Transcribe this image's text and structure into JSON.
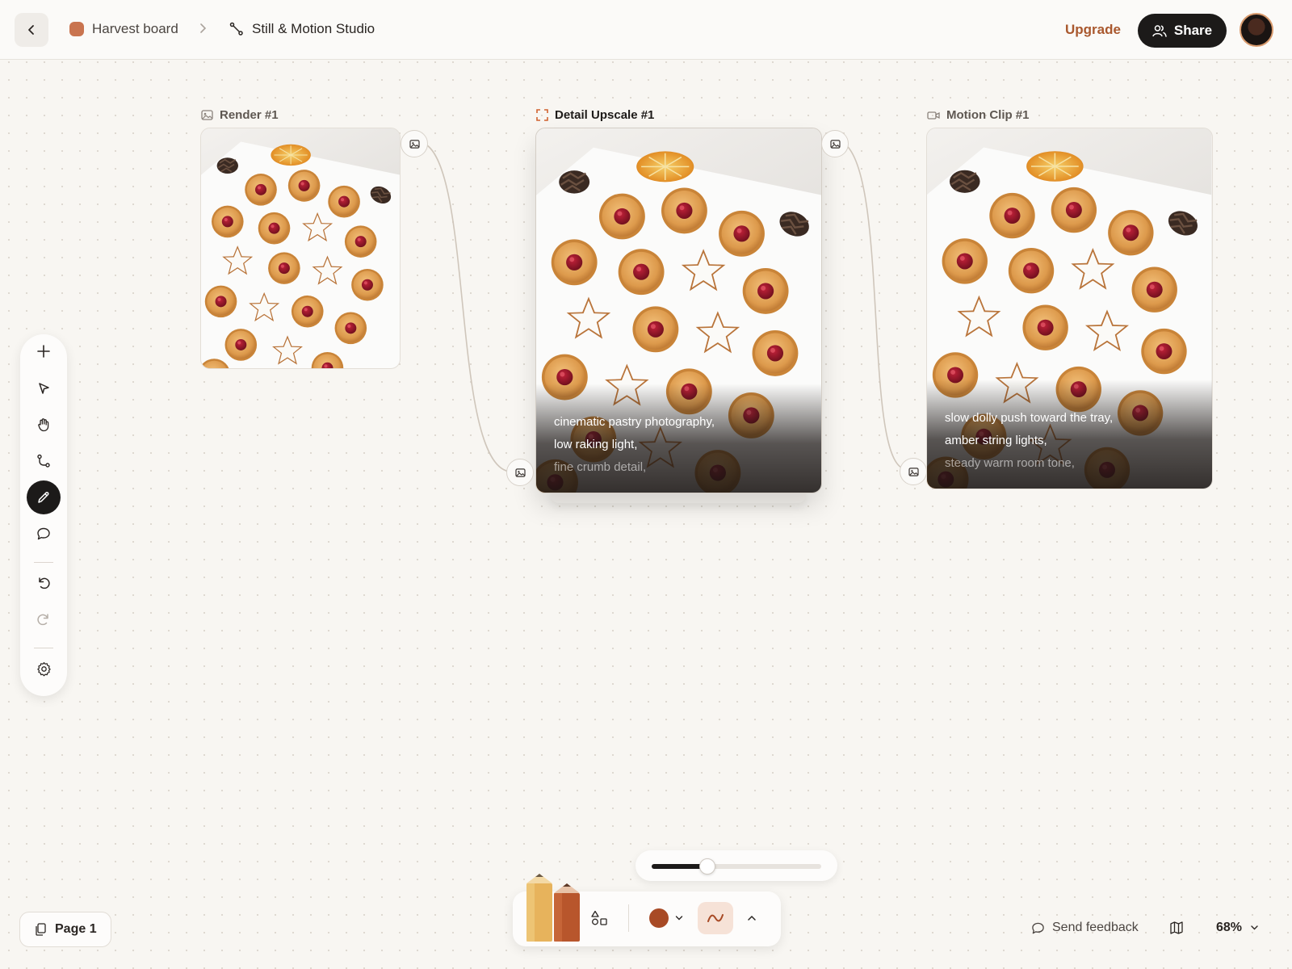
{
  "header": {
    "board_name": "Harvest board",
    "studio_name": "Still & Motion Studio",
    "upgrade_label": "Upgrade",
    "share_label": "Share",
    "board_color": "#c9744f"
  },
  "nodes": [
    {
      "id": "render",
      "title": "Render #1",
      "icon": "image-icon",
      "kind": "image"
    },
    {
      "id": "upscale",
      "title": "Detail Upscale #1",
      "icon": "upscale-frame-icon",
      "kind": "upscale",
      "prompt": [
        "cinematic pastry photography,",
        "low raking light,",
        "fine crumb detail,"
      ]
    },
    {
      "id": "motion",
      "title": "Motion Clip #1",
      "icon": "video-camera-icon",
      "kind": "video",
      "prompt": [
        "slow dolly push toward the tray,",
        "amber string lights,",
        "steady warm room tone,"
      ]
    }
  ],
  "toolbar": {
    "tools": [
      "add-icon",
      "select-pointer-icon",
      "hand-icon",
      "connect-icon",
      "pencil-icon",
      "comment-icon",
      "undo-icon",
      "redo-icon",
      "settings-gear-icon"
    ],
    "active_tool": "pencil-icon"
  },
  "page": {
    "label": "Page 1"
  },
  "drawing": {
    "stroke_size": 0.33,
    "color": "#a84a25",
    "pencil_colors": [
      "#e7b35c",
      "#b8562c"
    ]
  },
  "footer": {
    "feedback_label": "Send feedback",
    "zoom_label": "68%"
  }
}
